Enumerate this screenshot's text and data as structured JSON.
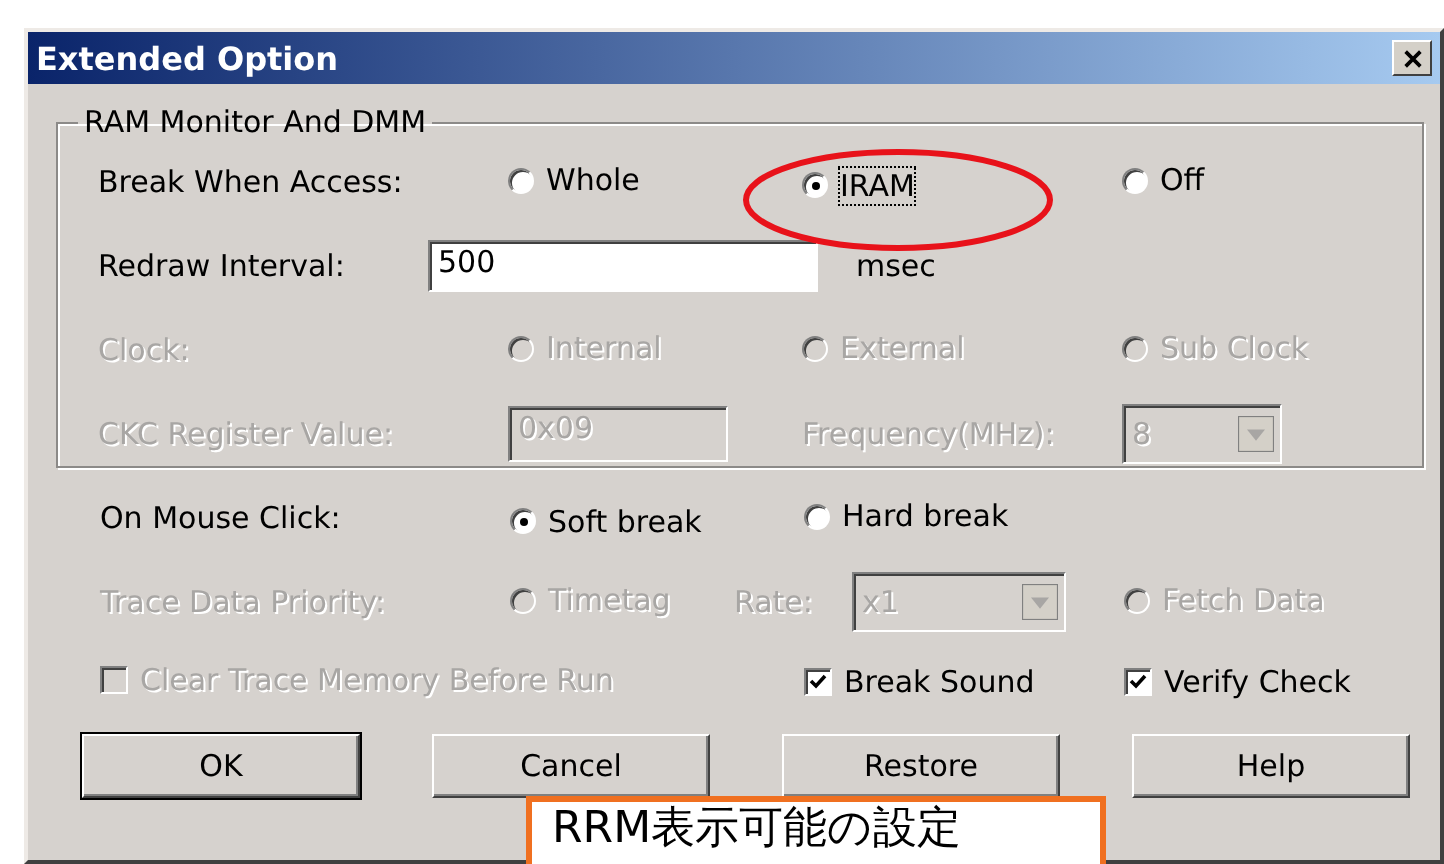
{
  "window": {
    "title": "Extended Option"
  },
  "group": {
    "title": "RAM Monitor And DMM",
    "rows": [
      {
        "kind": "choice",
        "items": [
          {
            "kind": "label",
            "text": "Break When Access:",
            "disabled": false
          },
          {
            "kind": "radio",
            "text": "Whole",
            "selected": false,
            "focused": false,
            "disabled": false
          },
          {
            "kind": "radio",
            "text": "IRAM",
            "selected": true,
            "focused": true,
            "disabled": false
          },
          {
            "kind": "radio",
            "text": "Off",
            "selected": false,
            "focused": false,
            "disabled": false
          }
        ]
      },
      {
        "kind": "entry",
        "items": [
          {
            "kind": "label",
            "text": "Redraw Interval:",
            "disabled": false
          },
          {
            "kind": "field",
            "value": "500",
            "disabled": false
          },
          {
            "kind": "unit",
            "text": "msec",
            "disabled": false
          }
        ]
      },
      {
        "kind": "choice",
        "items": [
          {
            "kind": "label",
            "text": "Clock:",
            "disabled": true
          },
          {
            "kind": "radio",
            "text": "Internal",
            "selected": false,
            "focused": false,
            "disabled": true
          },
          {
            "kind": "radio",
            "text": "External",
            "selected": false,
            "focused": false,
            "disabled": true
          },
          {
            "kind": "radio",
            "text": "Sub Clock",
            "selected": false,
            "focused": false,
            "disabled": true
          }
        ]
      },
      {
        "kind": "pair",
        "items": [
          {
            "kind": "label",
            "text": "CKC Register Value:",
            "disabled": true
          },
          {
            "kind": "field",
            "value": "0x09",
            "disabled": true
          },
          {
            "kind": "label",
            "text": "Frequency(MHz):",
            "disabled": true
          },
          {
            "kind": "combo",
            "value": "8",
            "disabled": true
          }
        ]
      }
    ]
  },
  "rows": [
    {
      "kind": "choice",
      "items": [
        {
          "kind": "label",
          "text": "On Mouse Click:",
          "disabled": false
        },
        {
          "kind": "radio",
          "text": "Soft break",
          "selected": true,
          "focused": false,
          "disabled": false
        },
        {
          "kind": "radio",
          "text": "Hard break",
          "selected": false,
          "focused": false,
          "disabled": false
        }
      ]
    },
    {
      "kind": "trace",
      "items": [
        {
          "kind": "label",
          "text": "Trace Data Priority:",
          "disabled": true
        },
        {
          "kind": "radio",
          "text": "Timetag",
          "selected": false,
          "focused": false,
          "disabled": true
        },
        {
          "kind": "label",
          "text": "Rate:",
          "disabled": true
        },
        {
          "kind": "combo",
          "value": "x1",
          "disabled": true
        },
        {
          "kind": "radio",
          "text": "Fetch Data",
          "selected": false,
          "focused": false,
          "disabled": true
        }
      ]
    },
    {
      "kind": "checks",
      "items": [
        {
          "kind": "checkbox",
          "text": "Clear Trace Memory Before Run",
          "checked": false,
          "disabled": true
        },
        {
          "kind": "checkbox",
          "text": "Break Sound",
          "checked": true,
          "disabled": false
        },
        {
          "kind": "checkbox",
          "text": "Verify Check",
          "checked": true,
          "disabled": false
        }
      ]
    }
  ],
  "buttons": [
    {
      "label": "OK",
      "default": true
    },
    {
      "label": "Cancel",
      "default": false
    },
    {
      "label": "Restore",
      "default": false
    },
    {
      "label": "Help",
      "default": false
    }
  ],
  "annotations": [
    {
      "kind": "ellipse",
      "color": "#e8121a"
    },
    {
      "kind": "callout",
      "text": "RRM表示可能の設定",
      "color": "#f07020"
    }
  ]
}
